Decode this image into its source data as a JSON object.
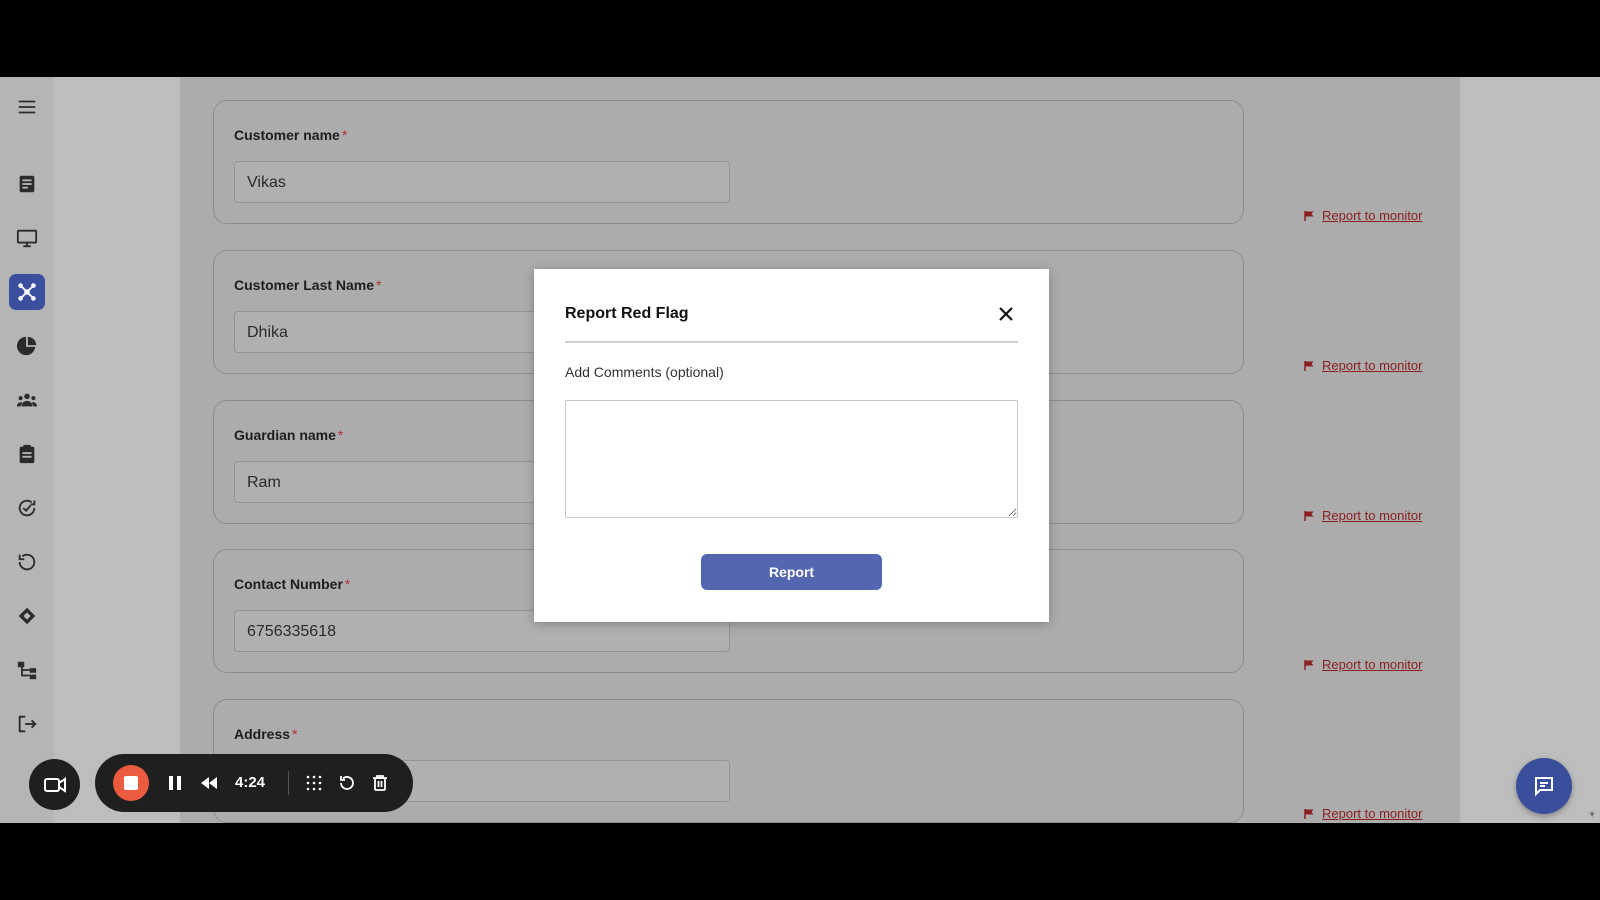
{
  "form": {
    "fields": [
      {
        "label": "Customer name",
        "value": "Vikas",
        "required_mark": "*"
      },
      {
        "label": "Customer Last Name",
        "value": "Dhika",
        "required_mark": "*"
      },
      {
        "label": "Guardian name",
        "value": "Ram",
        "required_mark": "*"
      },
      {
        "label": "Contact Number",
        "value": "6756335618",
        "required_mark": "*"
      },
      {
        "label": "Address",
        "value": "",
        "required_mark": "*"
      }
    ],
    "flag_link_label": "Report to monitor"
  },
  "sidebar": {
    "icons": [
      "menu-icon",
      "document-icon",
      "monitor-icon",
      "network-icon",
      "pie-chart-icon",
      "users-icon",
      "clipboard-icon",
      "verified-icon",
      "refresh-icon",
      "handshake-icon",
      "hierarchy-icon",
      "logout-icon"
    ],
    "active_index": 3
  },
  "modal": {
    "title": "Report Red Flag",
    "comment_label": "Add Comments (optional)",
    "comment_value": "",
    "report_button": "Report"
  },
  "recorder": {
    "elapsed": "4:24"
  },
  "colors": {
    "accent": "#3a4f9e",
    "record": "#ec5a3f",
    "flag": "#8a1f1f"
  }
}
